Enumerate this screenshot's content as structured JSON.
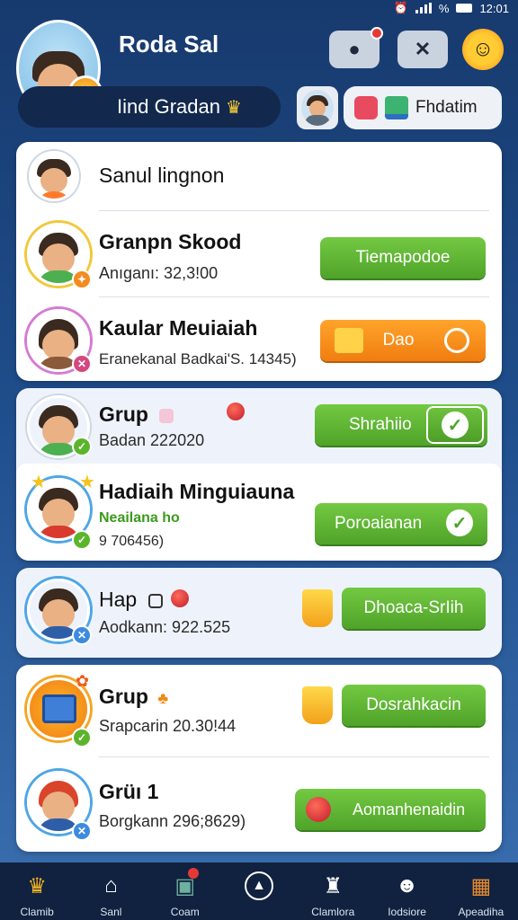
{
  "status_bar": {
    "time": "12:01",
    "battery": "%"
  },
  "header": {
    "username": "Roda Sal",
    "grade": "Iind Gradan",
    "pill_label": "Fhdatim"
  },
  "cards": [
    {
      "rows": [
        {
          "title": "Sanul lingnon",
          "subtitle": "",
          "button": ""
        },
        {
          "title": "Granpn Skood",
          "subtitle": "Anıganı: 32,3!00",
          "button": "Tiemapodoe"
        },
        {
          "title": "Kaular Meuiaiah",
          "subtitle": "Eranekanal Badkai'S. 14345)",
          "button": "Dao"
        }
      ]
    },
    {
      "rows": [
        {
          "title": "Grup",
          "subtitle": "Badan 222020",
          "button": "Shrahiio"
        },
        {
          "title": "Hadiaih Minguiauna",
          "subtitle_top": "Neailana ho",
          "subtitle": "9 706456)",
          "button": "Poroaianan"
        }
      ]
    },
    {
      "rows": [
        {
          "title": "Hap",
          "subtitle": "Aodkann: 922.525",
          "button": "Dhoaca-SrIih"
        }
      ]
    },
    {
      "rows": [
        {
          "title": "Grup",
          "subtitle": "Srapcarin 20.30!44",
          "button": "Dosrahkacin"
        },
        {
          "title": "Grüı 1",
          "subtitle": "Borgkann 296;8629)",
          "button": "Aomanhenaidin"
        }
      ]
    }
  ],
  "nav": [
    {
      "label": "Clamib",
      "icon": "trophy-icon"
    },
    {
      "label": "Sanl",
      "icon": "home-icon"
    },
    {
      "label": "Coam",
      "icon": "chest-icon"
    },
    {
      "label": "",
      "icon": "play-icon"
    },
    {
      "label": "Clamlora",
      "icon": "castle-icon"
    },
    {
      "label": "Iodsiore",
      "icon": "profile-icon"
    },
    {
      "label": "Apeadiha",
      "icon": "treasure-icon"
    }
  ],
  "colors": {
    "accent_green": "#4fa329",
    "accent_orange": "#f07d10",
    "background_top": "#173a6e",
    "nav_background": "#10223f"
  }
}
